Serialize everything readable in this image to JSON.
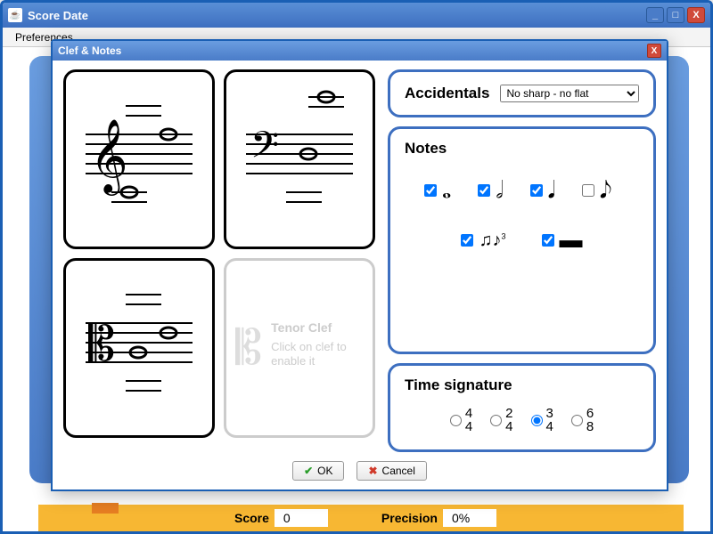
{
  "outer": {
    "title": "Score Date",
    "menu": {
      "preferences": "Preferences"
    },
    "status": {
      "score_label": "Score",
      "score_value": "0",
      "precision_label": "Precision",
      "precision_value": "0%"
    }
  },
  "dialog": {
    "title": "Clef & Notes",
    "clefs": {
      "tenor_disabled_title": "Tenor Clef",
      "tenor_disabled_hint": "Click on clef to enable it"
    },
    "accidentals": {
      "label": "Accidentals",
      "selected": "No sharp - no flat"
    },
    "notes": {
      "label": "Notes",
      "whole": {
        "checked": true
      },
      "half": {
        "checked": true
      },
      "quarter": {
        "checked": true
      },
      "eighth": {
        "checked": false
      },
      "triplet": {
        "checked": true
      },
      "rest": {
        "checked": true
      }
    },
    "time_signature": {
      "label": "Time signature",
      "options": [
        {
          "top": "4",
          "bottom": "4",
          "selected": false
        },
        {
          "top": "2",
          "bottom": "4",
          "selected": false
        },
        {
          "top": "3",
          "bottom": "4",
          "selected": true
        },
        {
          "top": "6",
          "bottom": "8",
          "selected": false
        }
      ]
    },
    "buttons": {
      "ok": "OK",
      "cancel": "Cancel"
    }
  }
}
